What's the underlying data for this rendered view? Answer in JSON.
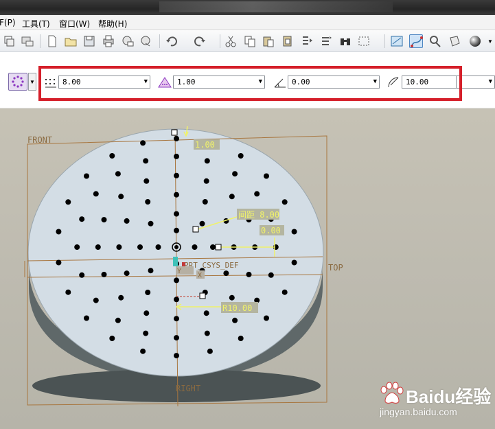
{
  "menubar": {
    "items": [
      "F(P)",
      "工具(T)",
      "窗口(W)",
      "帮助(H)"
    ]
  },
  "toolbar": {
    "icons": [
      "layers-icon",
      "print-icon",
      "new-file-icon",
      "open-folder-icon",
      "save-icon",
      "print-preview-icon",
      "email-icon",
      "send-icon",
      "undo-icon",
      "redo-icon",
      "cut-icon",
      "copy-icon",
      "paste-icon",
      "paste-special-icon",
      "regenerate-icon",
      "find-icon",
      "select-box-icon",
      "sketch-view-icon",
      "spline-icon",
      "settings-icon",
      "orient-icon",
      "shade-sphere-icon"
    ]
  },
  "dashboard": {
    "spacing_value": "8.00",
    "radial_step_value": "1.00",
    "angle_value": "0.00",
    "radius_value": "10.00"
  },
  "viewport": {
    "plane_front": "FRONT",
    "plane_top": "TOP",
    "plane_right": "RIGHT",
    "csys_label": "PRT_CSYS_DEF",
    "spacing_dim": "间距 8.00",
    "radial_dim": "1.00",
    "offset_dim": "0.00",
    "radius_dim": "R10.00",
    "small_x_label": "X",
    "small_y_label": "Y"
  },
  "watermark": {
    "brand": "Baidu经验",
    "url": "jingyan.baidu.com"
  },
  "colors": {
    "highlight_border": "#d51f2a",
    "disc_face": "#d3dde5",
    "disc_side": "#5f6869",
    "dimension_yellow": "#f0f26a",
    "plane_orange": "#a8763f"
  }
}
